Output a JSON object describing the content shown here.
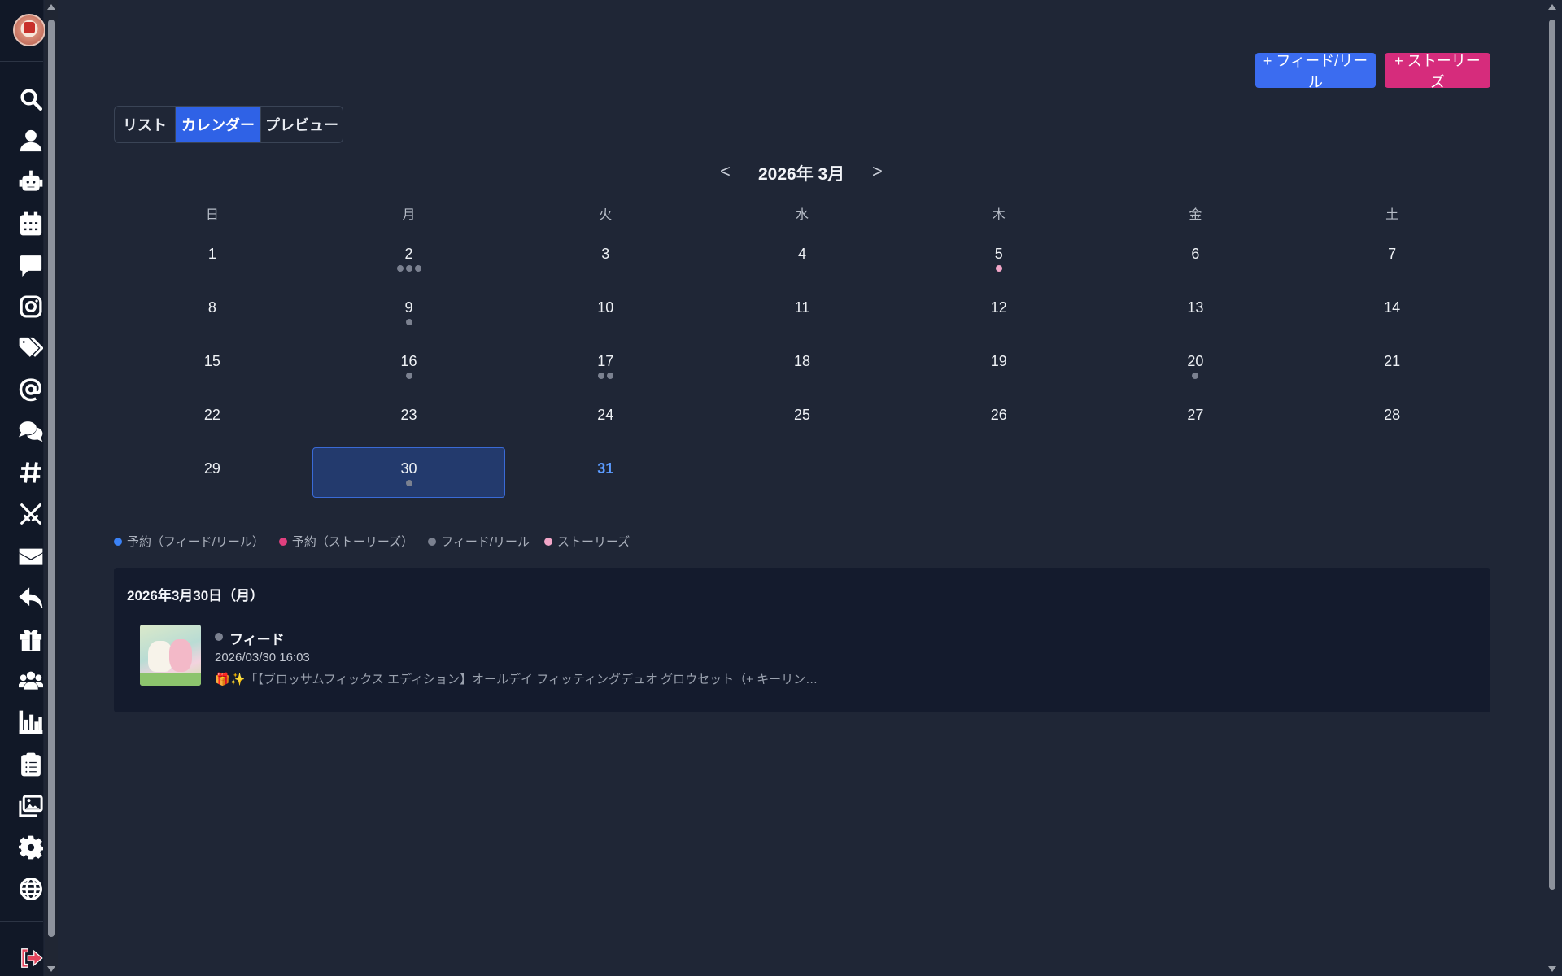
{
  "sidebar": {
    "icons": [
      "search-icon",
      "user-icon",
      "robot-icon",
      "calendar-icon",
      "comment-icon",
      "instagram-icon",
      "tags-icon",
      "at-icon",
      "comments-icon",
      "hashtag-icon",
      "swords-icon",
      "envelope-icon",
      "reply-icon",
      "gift-icon",
      "users-icon",
      "chart-bar-icon",
      "clipboard-icon",
      "images-icon",
      "gear-icon",
      "globe-icon",
      "logout-icon"
    ]
  },
  "header": {
    "feed_button": "+ フィード/リール",
    "stories_button": "+ ストーリーズ"
  },
  "view_toggle": {
    "tabs": [
      {
        "label": "リスト",
        "active": false
      },
      {
        "label": "カレンダー",
        "active": true
      },
      {
        "label": "プレビュー",
        "active": false
      }
    ]
  },
  "calendar": {
    "prev": "<",
    "title": "2026年 3月",
    "next": ">",
    "weekdays": [
      "日",
      "月",
      "火",
      "水",
      "木",
      "金",
      "土"
    ],
    "weeks": [
      [
        {
          "d": "1",
          "dots": []
        },
        {
          "d": "2",
          "dots": [
            "gray",
            "gray",
            "gray"
          ]
        },
        {
          "d": "3",
          "dots": []
        },
        {
          "d": "4",
          "dots": []
        },
        {
          "d": "5",
          "dots": [
            "pink"
          ]
        },
        {
          "d": "6",
          "dots": []
        },
        {
          "d": "7",
          "dots": []
        }
      ],
      [
        {
          "d": "8",
          "dots": []
        },
        {
          "d": "9",
          "dots": [
            "gray"
          ]
        },
        {
          "d": "10",
          "dots": []
        },
        {
          "d": "11",
          "dots": []
        },
        {
          "d": "12",
          "dots": []
        },
        {
          "d": "13",
          "dots": []
        },
        {
          "d": "14",
          "dots": []
        }
      ],
      [
        {
          "d": "15",
          "dots": []
        },
        {
          "d": "16",
          "dots": [
            "gray"
          ]
        },
        {
          "d": "17",
          "dots": [
            "gray",
            "gray"
          ]
        },
        {
          "d": "18",
          "dots": []
        },
        {
          "d": "19",
          "dots": []
        },
        {
          "d": "20",
          "dots": [
            "gray"
          ]
        },
        {
          "d": "21",
          "dots": []
        }
      ],
      [
        {
          "d": "22",
          "dots": []
        },
        {
          "d": "23",
          "dots": []
        },
        {
          "d": "24",
          "dots": []
        },
        {
          "d": "25",
          "dots": []
        },
        {
          "d": "26",
          "dots": []
        },
        {
          "d": "27",
          "dots": []
        },
        {
          "d": "28",
          "dots": []
        }
      ],
      [
        {
          "d": "29",
          "dots": []
        },
        {
          "d": "30",
          "dots": [
            "gray"
          ],
          "selected": true
        },
        {
          "d": "31",
          "dots": [],
          "today": true
        },
        {
          "d": "",
          "dots": []
        },
        {
          "d": "",
          "dots": []
        },
        {
          "d": "",
          "dots": []
        },
        {
          "d": "",
          "dots": []
        }
      ]
    ],
    "dot_colors": {
      "gray": "#7b8190",
      "pink": "#f2a6c8",
      "blue": "#3b82f6",
      "magenta": "#e0407f"
    }
  },
  "legend": [
    {
      "label": "予約（フィード/リール）",
      "color": "#3b82f6"
    },
    {
      "label": "予約（ストーリーズ）",
      "color": "#e0407f"
    },
    {
      "label": "フィード/リール",
      "color": "#7b8190"
    },
    {
      "label": "ストーリーズ",
      "color": "#f2a6c8"
    }
  ],
  "detail": {
    "date": "2026年3月30日（月）",
    "post": {
      "type": "フィード",
      "time": "2026/03/30 16:03",
      "caption": "🎁✨「【ブロッサムフィックス エディション】オールデイ フィッティングデュオ グロウセット（+ キーリン…"
    }
  }
}
